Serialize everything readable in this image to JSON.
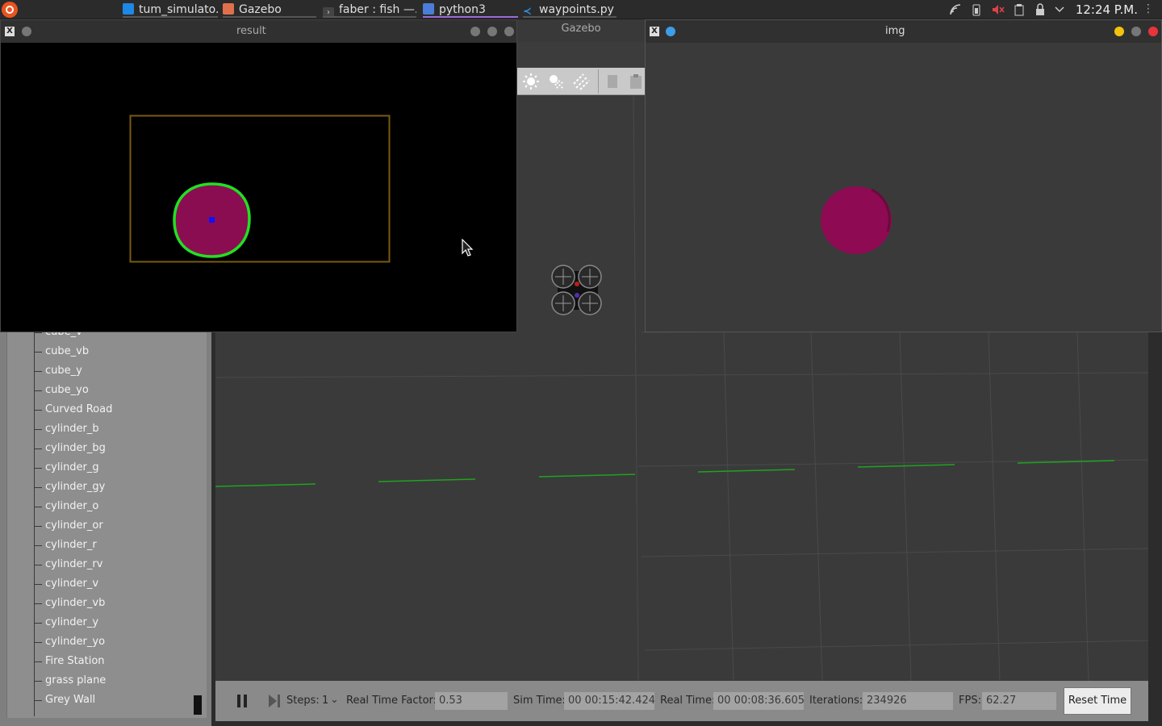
{
  "taskbar": {
    "tasks": [
      {
        "label": "tum_simulato...",
        "icon": "folder-icon",
        "color": "#1e88e5"
      },
      {
        "label": "Gazebo",
        "icon": "gazebo-icon",
        "color": "#e0704c"
      },
      {
        "label": "faber : fish —...",
        "icon": "terminal-icon",
        "color": "#555555"
      },
      {
        "label": "python3",
        "icon": "python-icon",
        "color": "#4a7ed8"
      },
      {
        "label": "waypoints.py ...",
        "icon": "vscode-icon",
        "color": "#2d8fe0"
      }
    ],
    "active_task": "python3",
    "clock": "12:24 P.M.",
    "tray_icons": [
      "wifi-icon",
      "battery-icon",
      "volume-muted-icon",
      "clipboard-icon",
      "lock-icon",
      "chevron-down-icon"
    ]
  },
  "gazebo": {
    "title": "Gazebo",
    "toolbar_icons": [
      "sun-light-icon",
      "spot-light-icon",
      "directional-light-icon",
      "copy-icon",
      "paste-icon"
    ],
    "model_list": [
      "cube_v",
      "cube_vb",
      "cube_y",
      "cube_yo",
      "Curved Road",
      "cylinder_b",
      "cylinder_bg",
      "cylinder_g",
      "cylinder_gy",
      "cylinder_o",
      "cylinder_or",
      "cylinder_r",
      "cylinder_rv",
      "cylinder_v",
      "cylinder_vb",
      "cylinder_y",
      "cylinder_yo",
      "Fire Station",
      "grass plane",
      "Grey Wall"
    ],
    "bottom_bar": {
      "steps_label": "Steps:",
      "steps_value": "1",
      "rtf_label": "Real Time Factor:",
      "rtf_value": "0.53",
      "sim_time_label": "Sim Time:",
      "sim_time_value": "00 00:15:42.424",
      "real_time_label": "Real Time:",
      "real_time_value": "00 00:08:36.605",
      "iterations_label": "Iterations:",
      "iterations_value": "234926",
      "fps_label": "FPS:",
      "fps_value": "62.27",
      "reset_label": "Reset Time"
    }
  },
  "result_window": {
    "title": "result",
    "colors": {
      "frame": "#7a5a10",
      "contour": "#22e022",
      "blob": "#8a0d52",
      "centroid": "#1010ff"
    }
  },
  "img_window": {
    "title": "img",
    "colors": {
      "blob": "#8e0a52",
      "minimize": "#f4c20d",
      "maximize": "#777777",
      "close": "#e8343a",
      "pin": "#3d9de8"
    }
  }
}
